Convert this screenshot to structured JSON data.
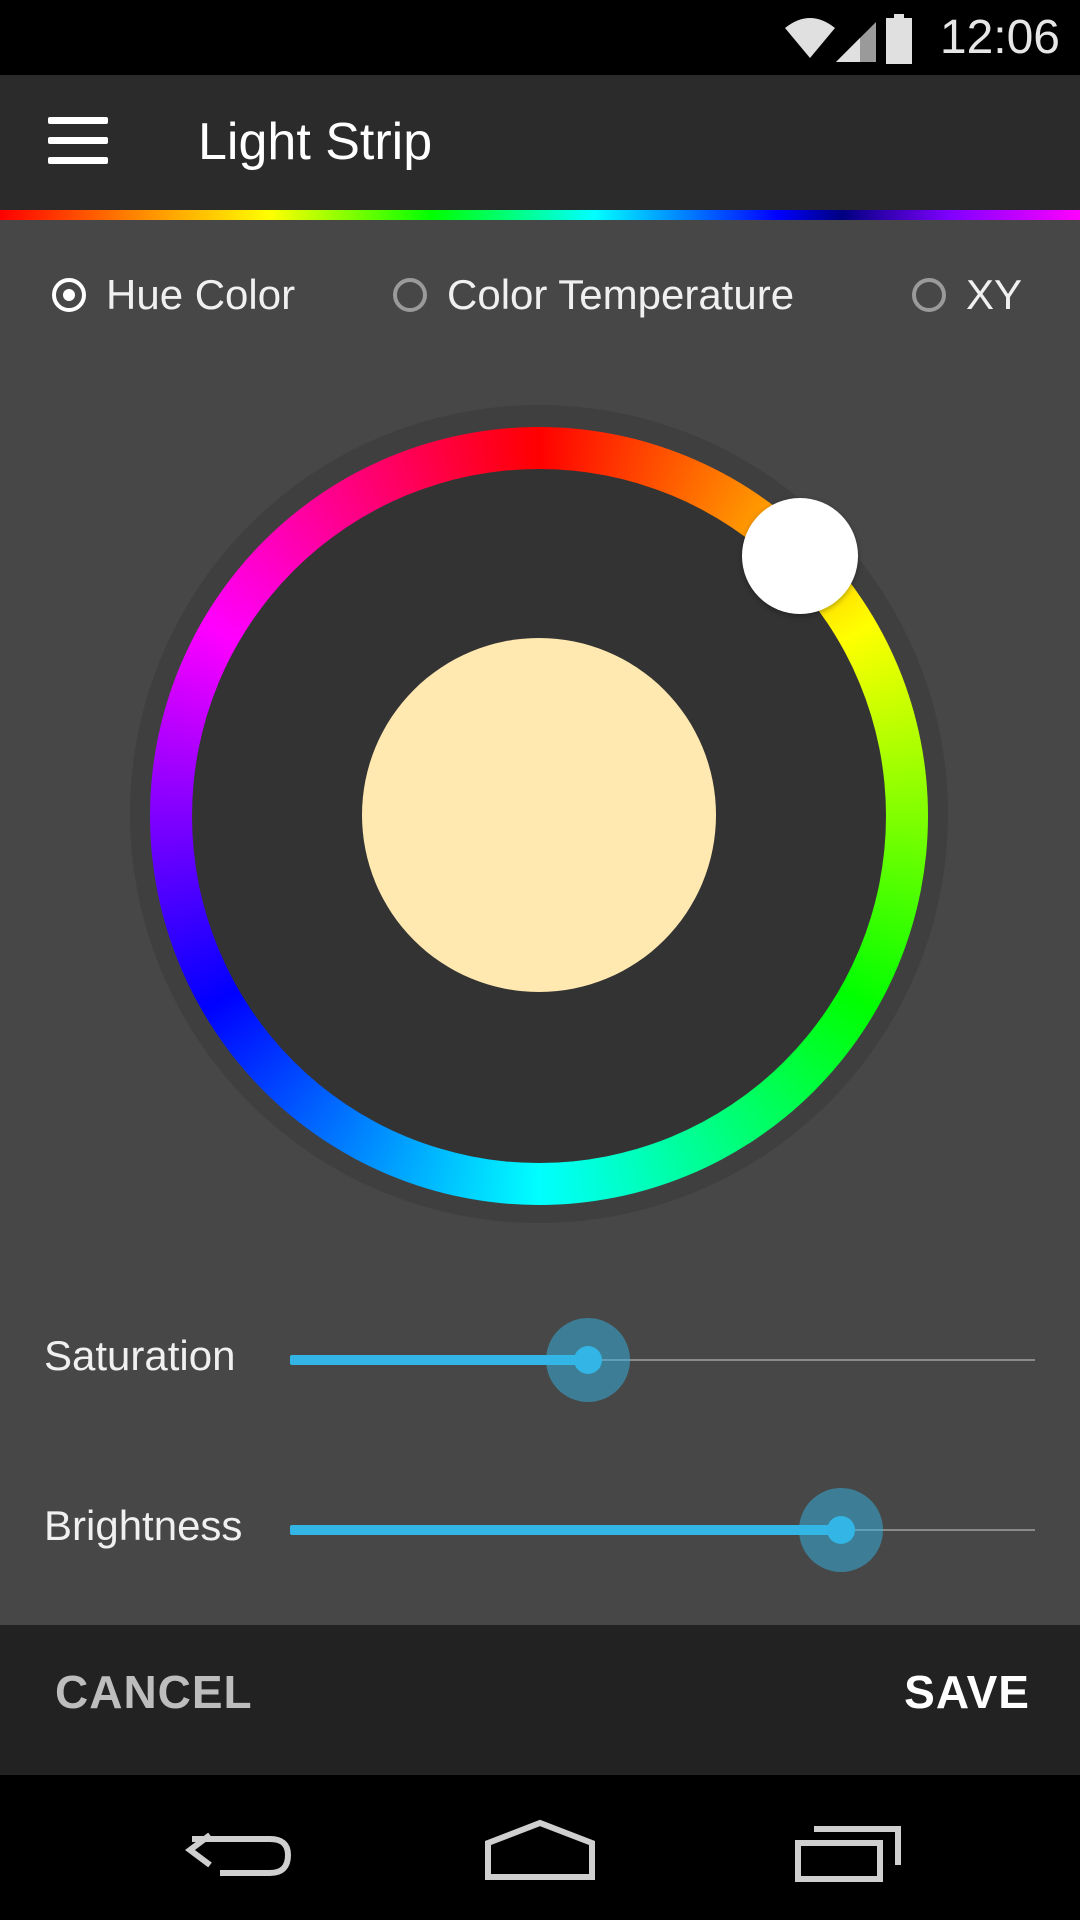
{
  "status_bar": {
    "time": "12:06",
    "icons": [
      "wifi-icon",
      "signal-icon",
      "battery-icon"
    ]
  },
  "app_bar": {
    "menu_icon": "hamburger-menu-icon",
    "title": "Light Strip"
  },
  "mode_options": [
    {
      "label": "Hue Color",
      "selected": true
    },
    {
      "label": "Color Temperature",
      "selected": false
    },
    {
      "label": "XY",
      "selected": false
    }
  ],
  "color_wheel": {
    "preview_color": "#ffe9b0",
    "knob_color": "#ffffff"
  },
  "sliders": {
    "saturation": {
      "label": "Saturation",
      "value": 0.4
    },
    "brightness": {
      "label": "Brightness",
      "value": 0.74
    }
  },
  "actions": {
    "cancel_label": "CANCEL",
    "save_label": "SAVE"
  },
  "nav_bar": {
    "icons": [
      "back-icon",
      "home-icon",
      "recent-apps-icon"
    ]
  },
  "colors": {
    "accent": "#33b5e5",
    "background": "#474747",
    "app_bar": "#2b2b2b"
  }
}
